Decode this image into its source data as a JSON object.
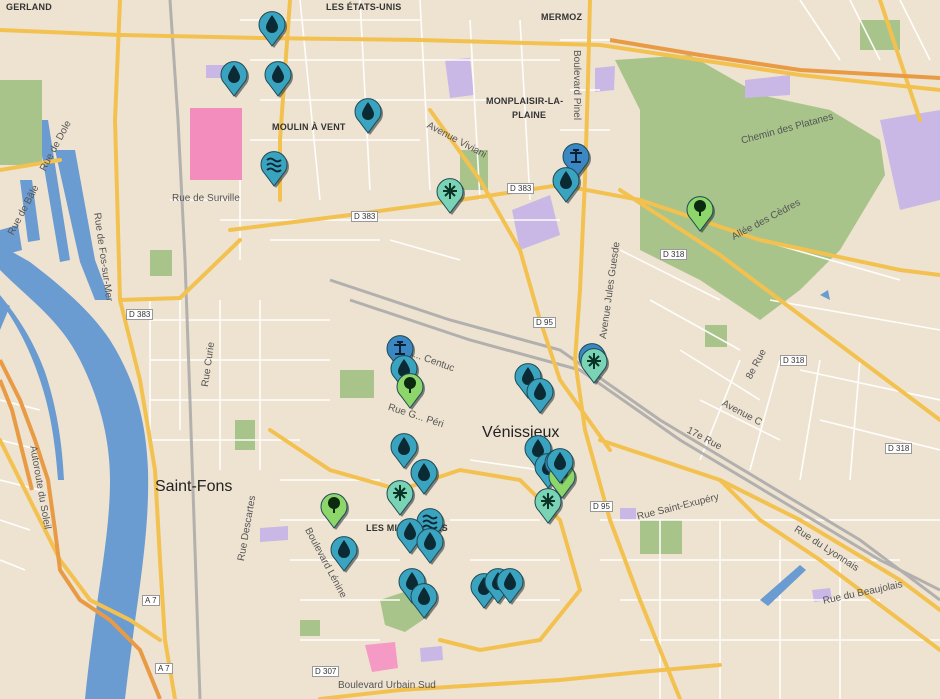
{
  "map": {
    "colors": {
      "land": "#eee3d1",
      "water": "#6a9bd1",
      "park": "#a8c48a",
      "road_major": "#f3c14f",
      "road_minor": "#ffffff",
      "industrial": "#c9b8e6",
      "pin_water": "#3aa3c0",
      "pin_nature": "#8cd66a",
      "pin_snow": "#7ad3b5",
      "pin_fountain": "#3a87c4"
    },
    "district_labels": {
      "gerland": "GERLAND",
      "les_etats_unis": "LES ÉTATS-UNIS",
      "mermoz": "MERMOZ",
      "moulin_a_vent": "MOULIN À VENT",
      "monplaisir_1": "MONPLAISIR-LA-",
      "monplaisir_2": "PLAINE",
      "les_minguettes": "LES MINGUETTES"
    },
    "city_labels": {
      "venissieux": "Vénissieux",
      "saint_fons": "Saint-Fons"
    },
    "street_labels": {
      "rue_de_surville": "Rue de Surville",
      "avenue_viviani": "Avenue Viviani",
      "boulevard_pinel": "Boulevard Pinel",
      "chemin_des_platanes": "Chemin des Platanes",
      "allee_des_cedres": "Allée des Cèdres",
      "avenue_jules_guesde": "Avenue Jules Guesde",
      "rue_de_dole": "Rue de Dole",
      "rue_de_bale": "Rue de Bâle",
      "rue_de_fos_sur_mer": "Rue de Fos-sur-Mer",
      "rue_curie": "Rue Curie",
      "rue_ambroise_centuc": "Rue A... Centuc",
      "rue_gabriel_peri": "Rue G... Péri",
      "rue_descartes": "Rue Descartes",
      "boulevard_lenine": "Boulevard Lénine",
      "boulevard_urbain_sud": "Boulevard Urbain Sud",
      "rue_saint_exupery": "Rue Saint-Exupéry",
      "rue_du_lyonnais": "Rue du Lyonnais",
      "rue_du_beaujolais": "Rue du Beaujolais",
      "avenue_c": "Avenue C",
      "rue_17e": "17e Rue",
      "rue_8e": "8e Rue",
      "autoroute_du_soleil": "Autoroute du Soleil"
    },
    "road_shields": {
      "d383_a": "D 383",
      "d383_b": "D 383",
      "d383_c": "D 383",
      "d318_a": "D 318",
      "d318_b": "D 318",
      "d318_c": "D 318",
      "d95_a": "D 95",
      "d95_b": "D 95",
      "d307": "D 307",
      "a7_a": "A 7",
      "a7_b": "A 7"
    },
    "pins": [
      {
        "type": "water"
      },
      {
        "type": "water"
      },
      {
        "type": "water"
      },
      {
        "type": "water"
      },
      {
        "type": "wave"
      },
      {
        "type": "snow"
      },
      {
        "type": "fountain"
      },
      {
        "type": "water"
      },
      {
        "type": "tree"
      },
      {
        "type": "fountain"
      },
      {
        "type": "water"
      },
      {
        "type": "tree"
      },
      {
        "type": "water"
      },
      {
        "type": "water"
      },
      {
        "type": "fountain"
      },
      {
        "type": "snow"
      },
      {
        "type": "water"
      },
      {
        "type": "water"
      },
      {
        "type": "water"
      },
      {
        "type": "water"
      },
      {
        "type": "fountain"
      },
      {
        "type": "tree"
      },
      {
        "type": "snow"
      },
      {
        "type": "tree"
      },
      {
        "type": "snow"
      },
      {
        "type": "wave"
      },
      {
        "type": "water"
      },
      {
        "type": "water"
      },
      {
        "type": "water"
      },
      {
        "type": "water"
      },
      {
        "type": "water"
      },
      {
        "type": "water"
      },
      {
        "type": "water"
      },
      {
        "type": "water"
      },
      {
        "type": "water"
      }
    ]
  }
}
